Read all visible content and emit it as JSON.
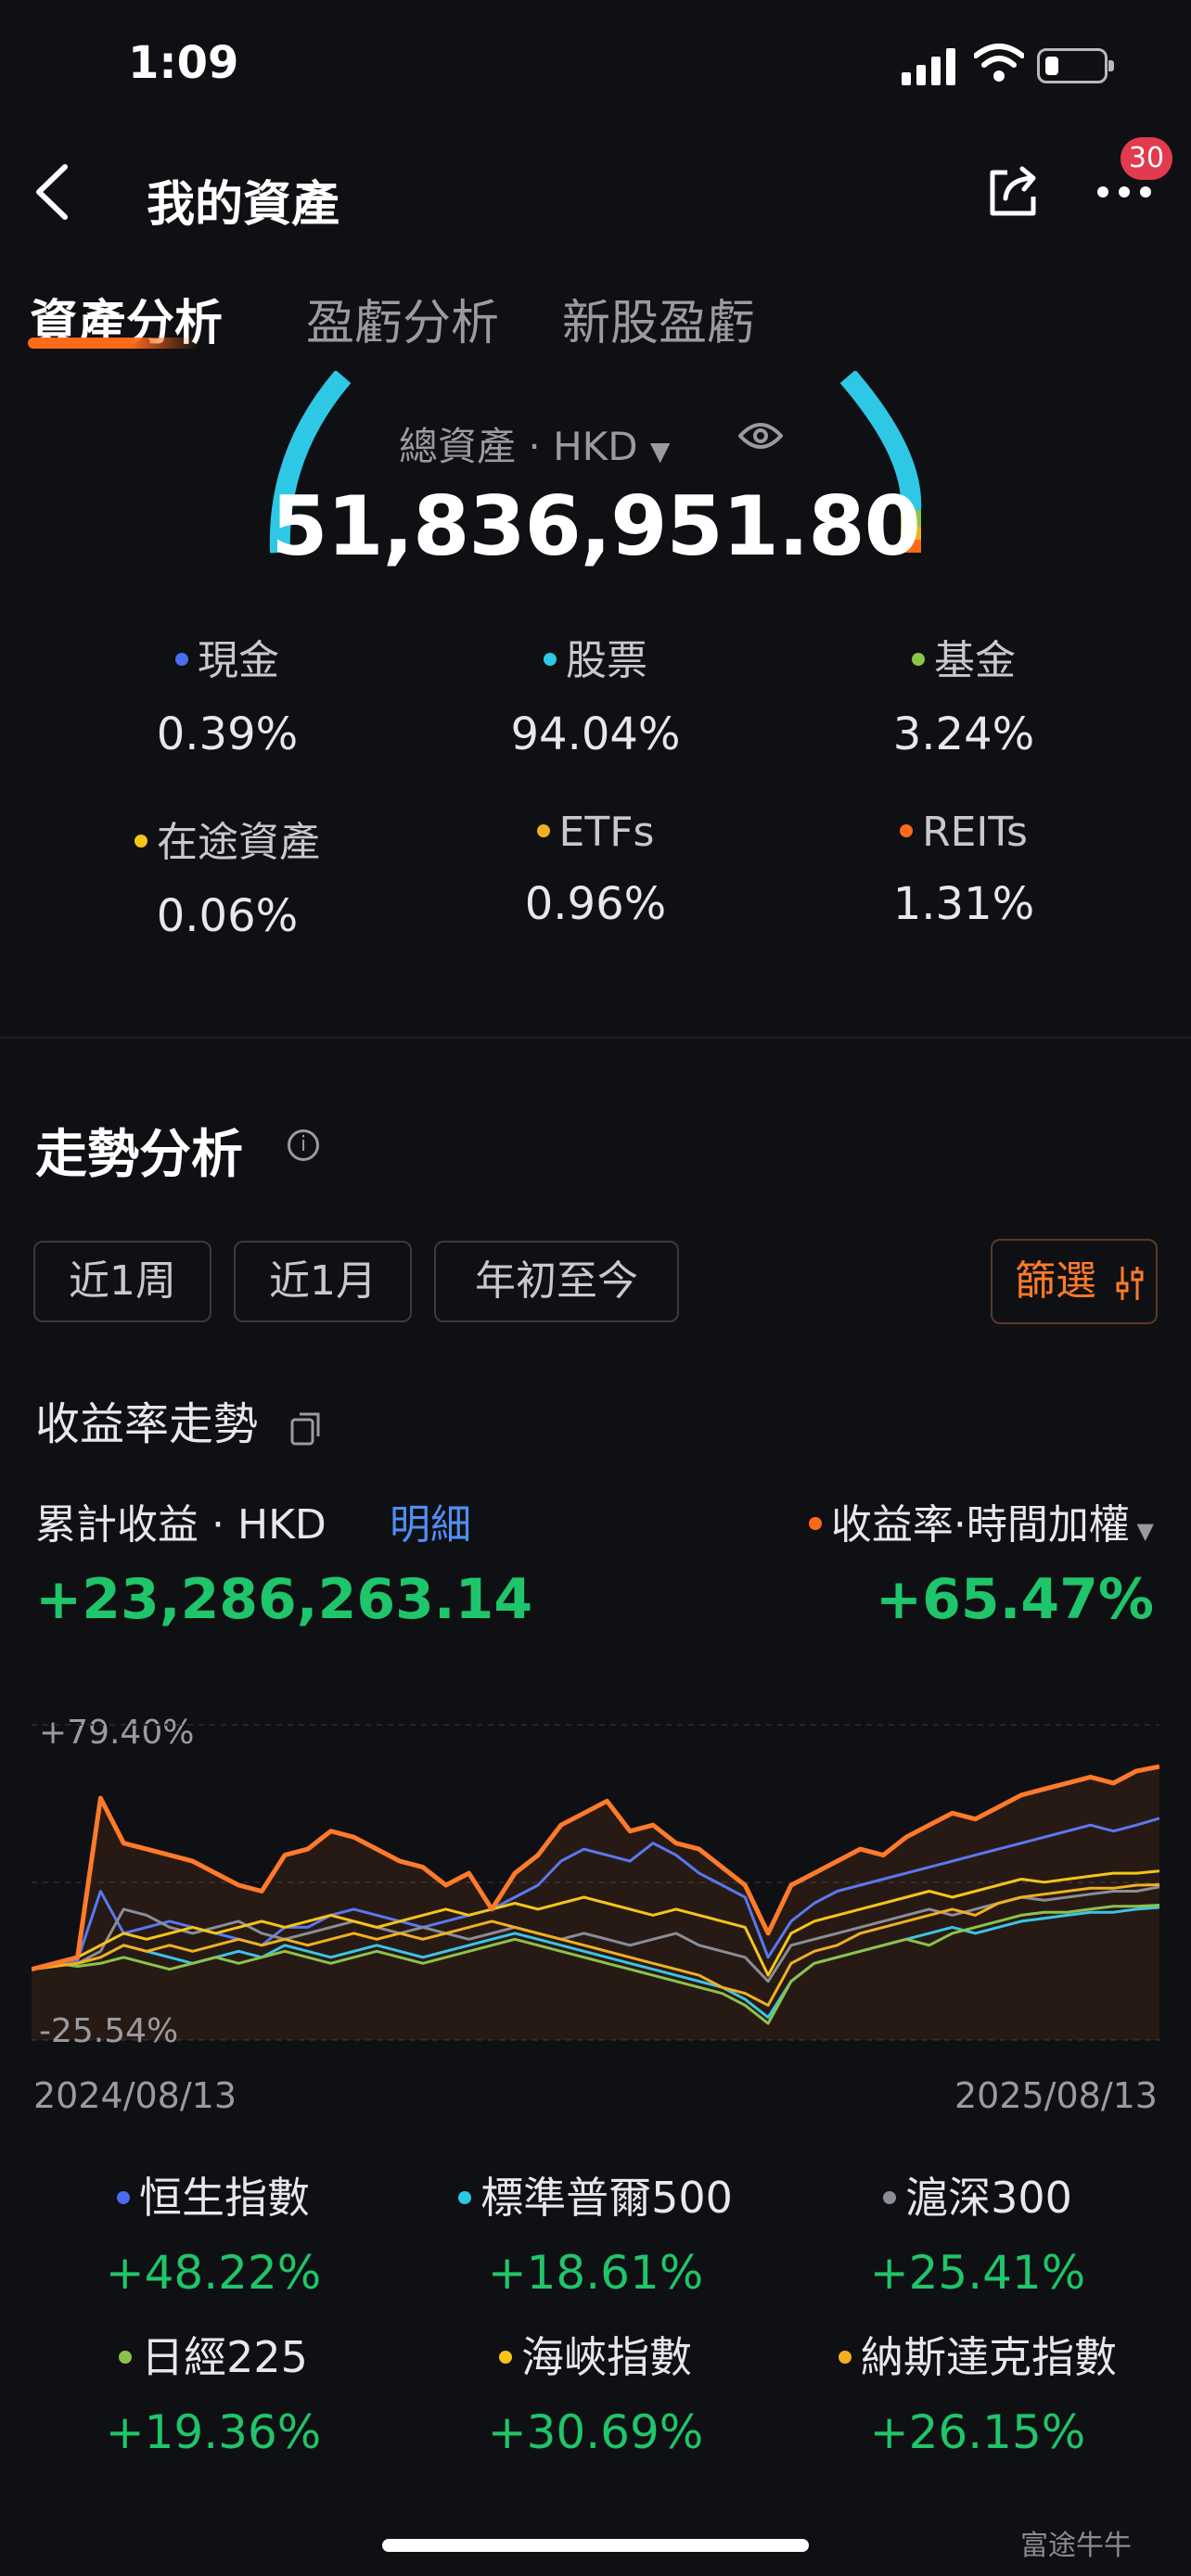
{
  "status": {
    "time": "1:09"
  },
  "nav": {
    "title": "我的資產",
    "badge": "30"
  },
  "tabs": [
    {
      "label": "資產分析",
      "active": true
    },
    {
      "label": "盈虧分析",
      "active": false
    },
    {
      "label": "新股盈虧",
      "active": false
    }
  ],
  "total": {
    "label": "總資產",
    "currency": "HKD",
    "value": "51,836,951.80"
  },
  "allocation": [
    {
      "name": "現金",
      "pct": "0.39%",
      "color": "#4a6cf0"
    },
    {
      "name": "股票",
      "pct": "94.04%",
      "color": "#2ec8e6"
    },
    {
      "name": "基金",
      "pct": "3.24%",
      "color": "#8bc34a"
    },
    {
      "name": "在途資產",
      "pct": "0.06%",
      "color": "#f5c518"
    },
    {
      "name": "ETFs",
      "pct": "0.96%",
      "color": "#f0b020"
    },
    {
      "name": "REITs",
      "pct": "1.31%",
      "color": "#ff6a1a"
    }
  ],
  "trend": {
    "title": "走勢分析",
    "periods": [
      "近1周",
      "近1月",
      "年初至今"
    ],
    "filter_label": "篩選",
    "return_title": "收益率走勢",
    "cumulative_label": "累計收益",
    "currency": "HKD",
    "detail_link": "明細",
    "rate_label": "收益率·時間加權",
    "cumulative_value": "+23,286,263.14",
    "rate_value": "+65.47%"
  },
  "chart_data": {
    "type": "line",
    "y_top_label": "+79.40%",
    "y_bottom_label": "-25.54%",
    "ylim": [
      -25.54,
      79.4
    ],
    "x_start": "2024/08/13",
    "x_end": "2025/08/13",
    "series": [
      {
        "name": "收益率",
        "color": "#ff7a2a",
        "values": [
          -2,
          0,
          2,
          55,
          40,
          38,
          36,
          34,
          30,
          26,
          24,
          36,
          38,
          44,
          42,
          38,
          34,
          32,
          26,
          30,
          18,
          30,
          36,
          46,
          50,
          54,
          44,
          46,
          40,
          38,
          32,
          26,
          10,
          26,
          30,
          34,
          38,
          36,
          42,
          46,
          50,
          48,
          52,
          56,
          58,
          60,
          62,
          60,
          64,
          65.47
        ]
      },
      {
        "name": "恒生指數",
        "color": "#5a78f0",
        "values": [
          -2,
          0,
          1,
          24,
          10,
          12,
          14,
          12,
          10,
          8,
          6,
          12,
          12,
          16,
          18,
          16,
          14,
          12,
          14,
          16,
          18,
          22,
          26,
          34,
          38,
          36,
          34,
          40,
          36,
          30,
          26,
          22,
          2,
          14,
          20,
          24,
          26,
          28,
          30,
          32,
          34,
          36,
          38,
          40,
          42,
          44,
          46,
          44,
          46,
          48.22
        ]
      },
      {
        "name": "標準普爾500",
        "color": "#3cc4e6",
        "values": [
          -2,
          -1,
          0,
          2,
          6,
          4,
          2,
          0,
          2,
          4,
          2,
          6,
          4,
          2,
          4,
          6,
          4,
          2,
          4,
          6,
          8,
          10,
          8,
          6,
          4,
          2,
          0,
          -2,
          -4,
          -6,
          -8,
          -12,
          -18,
          -6,
          0,
          2,
          4,
          6,
          8,
          10,
          12,
          10,
          12,
          14,
          15,
          16,
          17,
          17,
          18,
          18.61
        ]
      },
      {
        "name": "滬深300",
        "color": "#8a8d96",
        "values": [
          -2,
          -1,
          0,
          4,
          18,
          16,
          12,
          10,
          12,
          14,
          10,
          8,
          10,
          12,
          14,
          12,
          10,
          12,
          10,
          8,
          10,
          12,
          10,
          8,
          10,
          8,
          6,
          8,
          10,
          6,
          4,
          2,
          -6,
          6,
          8,
          10,
          12,
          14,
          16,
          18,
          16,
          18,
          20,
          22,
          21,
          22,
          23,
          24,
          24,
          25.41
        ]
      },
      {
        "name": "日經225",
        "color": "#8bc34a",
        "values": [
          -2,
          0,
          -1,
          0,
          2,
          0,
          -2,
          0,
          2,
          0,
          2,
          4,
          2,
          0,
          2,
          4,
          2,
          0,
          2,
          4,
          6,
          8,
          6,
          4,
          2,
          0,
          -2,
          -4,
          -6,
          -8,
          -10,
          -14,
          -20,
          -6,
          0,
          2,
          4,
          6,
          8,
          6,
          10,
          12,
          14,
          16,
          17,
          17,
          18,
          19,
          19,
          19.36
        ]
      },
      {
        "name": "海峽指數",
        "color": "#f5c518",
        "values": [
          -2,
          0,
          2,
          6,
          10,
          8,
          10,
          12,
          10,
          12,
          14,
          12,
          14,
          16,
          14,
          12,
          14,
          16,
          18,
          16,
          18,
          20,
          18,
          20,
          22,
          20,
          18,
          16,
          18,
          16,
          14,
          12,
          -4,
          10,
          14,
          16,
          18,
          20,
          22,
          24,
          22,
          24,
          26,
          28,
          27,
          28,
          29,
          30,
          30,
          30.69
        ]
      },
      {
        "name": "納斯達克指數",
        "color": "#f0b020",
        "values": [
          -2,
          -1,
          0,
          2,
          6,
          4,
          6,
          4,
          6,
          8,
          6,
          8,
          6,
          8,
          10,
          8,
          10,
          8,
          10,
          12,
          14,
          12,
          10,
          8,
          6,
          4,
          2,
          0,
          -2,
          -4,
          -8,
          -10,
          -14,
          0,
          4,
          6,
          10,
          12,
          14,
          16,
          18,
          16,
          20,
          22,
          23,
          24,
          25,
          25,
          26,
          26.15
        ]
      }
    ]
  },
  "benchmarks": [
    {
      "name": "恒生指數",
      "value": "+48.22%",
      "color": "#4a6cf0"
    },
    {
      "name": "標準普爾500",
      "value": "+18.61%",
      "color": "#2ec8e6"
    },
    {
      "name": "滬深300",
      "value": "+25.41%",
      "color": "#8a8d96"
    },
    {
      "name": "日經225",
      "value": "+19.36%",
      "color": "#8bc34a"
    },
    {
      "name": "海峽指數",
      "value": "+30.69%",
      "color": "#f5c518"
    },
    {
      "name": "納斯達克指數",
      "value": "+26.15%",
      "color": "#f0b020"
    }
  ],
  "watermark": "富途牛牛"
}
